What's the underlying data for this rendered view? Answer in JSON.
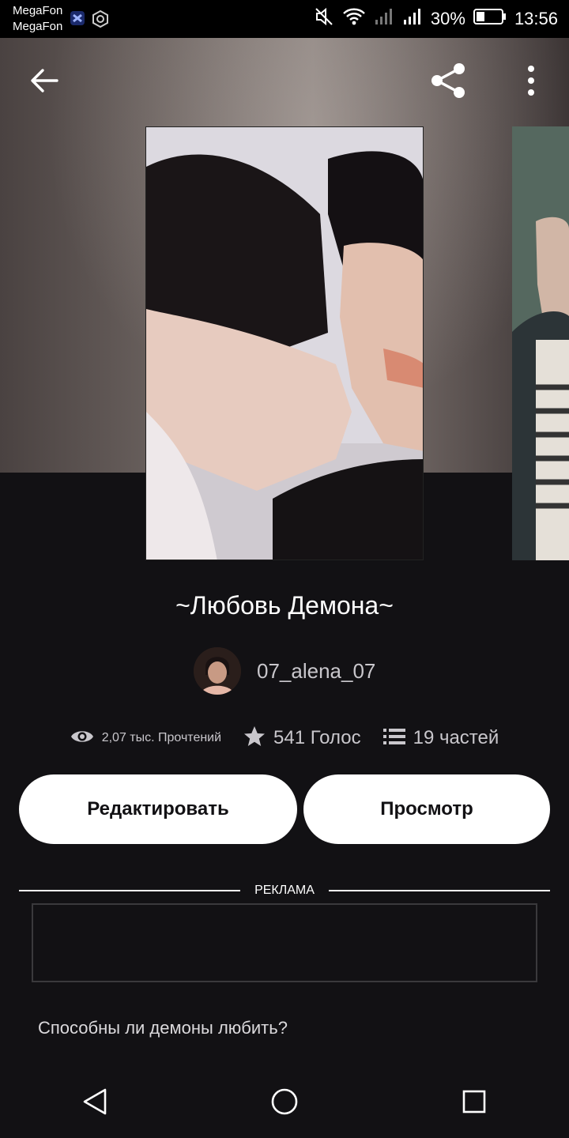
{
  "status_bar": {
    "carrier_1": "MegaFon",
    "carrier_2": "MegaFon",
    "battery": "30%",
    "time": "13:56",
    "icons": [
      "mute-icon",
      "wifi-icon",
      "signal-icon",
      "signal-icon",
      "battery-icon"
    ]
  },
  "header": {
    "back_icon": "arrow-left-icon",
    "share_icon": "share-icon",
    "menu_icon": "more-vertical-icon"
  },
  "story": {
    "title": "~Любовь Демона~",
    "author": "07_alena_07",
    "reads": "2,07 тыс. Прочтений",
    "votes": "541 Голос",
    "parts": "19 частей",
    "description": "Способны ли демоны любить?"
  },
  "actions": {
    "edit_label": "Редактировать",
    "view_label": "Просмотр"
  },
  "ad": {
    "label": "РЕКЛАМА"
  },
  "navbar": {
    "icons": [
      "back-triangle-icon",
      "home-circle-icon",
      "recents-square-icon"
    ]
  },
  "colors": {
    "background": "#121114",
    "button": "#ffffff",
    "text_muted": "#c9c7cc"
  }
}
